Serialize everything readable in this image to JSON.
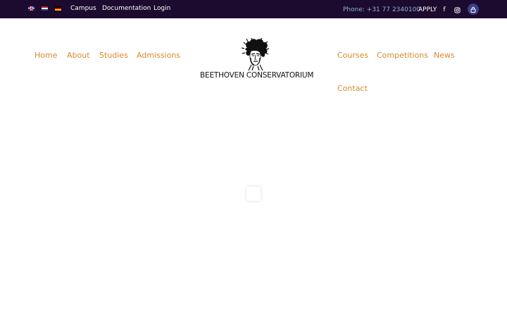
{
  "topbar": {
    "background": "#1c0b2e",
    "languages": [
      {
        "code": "en",
        "icon": "flag-uk-icon"
      },
      {
        "code": "nl",
        "icon": "flag-nl-icon"
      },
      {
        "code": "de",
        "icon": "flag-de-icon"
      }
    ],
    "links": {
      "campus": "Campus",
      "documentation": "Documentation",
      "login": "Login"
    },
    "phone": "Phone: +31 77 2340100",
    "apply": "APPLY",
    "social": {
      "facebook": "f",
      "instagram": "instagram-icon"
    },
    "user_icon": "lock-icon"
  },
  "nav": {
    "accent_color": "#d88a2c",
    "left": [
      "Home",
      "About",
      "Studies",
      "Admissions"
    ],
    "right": [
      "Courses",
      "Competitions",
      "News",
      "Contact"
    ]
  },
  "logo": {
    "text": "BEETHOVEN CONSERVATORIUM",
    "icon": "beethoven-portrait-icon"
  },
  "loader": {
    "icon": "loading-spinner-icon"
  }
}
